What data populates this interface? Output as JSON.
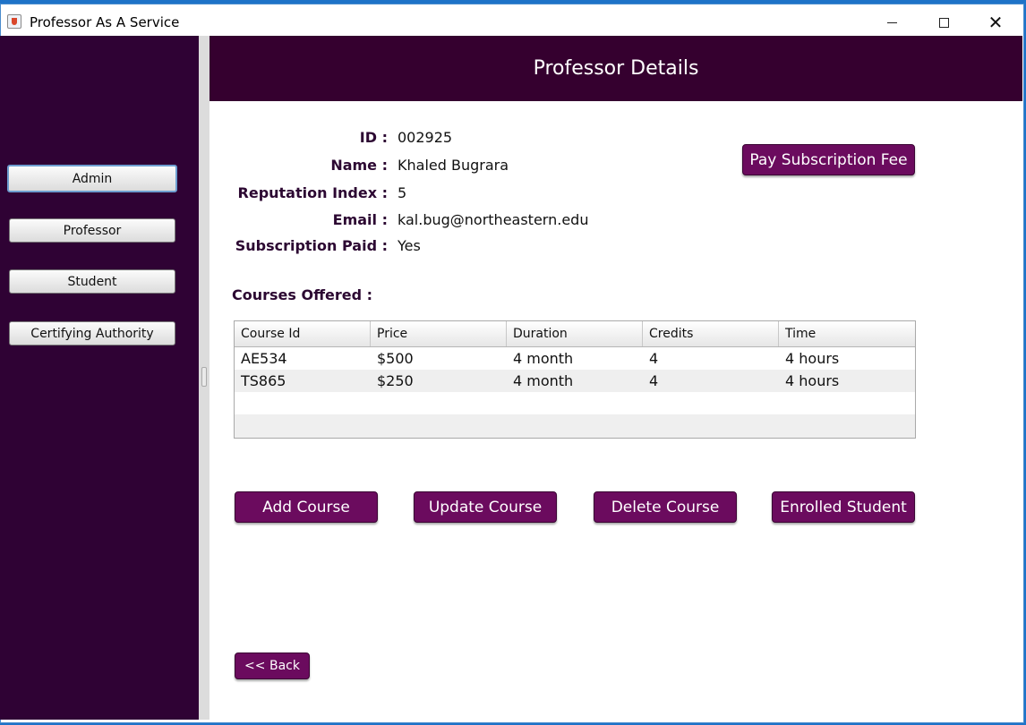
{
  "window": {
    "title": "Professor As A Service"
  },
  "sidebar": {
    "items": [
      {
        "label": "Admin"
      },
      {
        "label": "Professor"
      },
      {
        "label": "Student"
      },
      {
        "label": "Certifying Authority"
      }
    ]
  },
  "header": {
    "title": "Professor Details"
  },
  "details": {
    "id_label": "ID :",
    "id_value": "002925",
    "name_label": "Name :",
    "name_value": "Khaled Bugrara",
    "reputation_label": "Reputation Index :",
    "reputation_value": "5",
    "email_label": "Email :",
    "email_value": "kal.bug@northeastern.edu",
    "subscription_label": "Subscription Paid :",
    "subscription_value": "Yes"
  },
  "actions": {
    "pay_label": "Pay Subscription Fee",
    "add_label": "Add Course",
    "update_label": "Update Course",
    "delete_label": "Delete Course",
    "enrolled_label": "Enrolled Student",
    "back_label": "<< Back"
  },
  "courses": {
    "section_title": "Courses Offered :",
    "columns": [
      "Course Id",
      "Price",
      "Duration",
      "Credits",
      "Time"
    ],
    "rows": [
      [
        "AE534",
        "$500",
        "4 month",
        "4",
        "4 hours"
      ],
      [
        "TS865",
        "$250",
        "4 month",
        "4",
        "4 hours"
      ]
    ]
  }
}
